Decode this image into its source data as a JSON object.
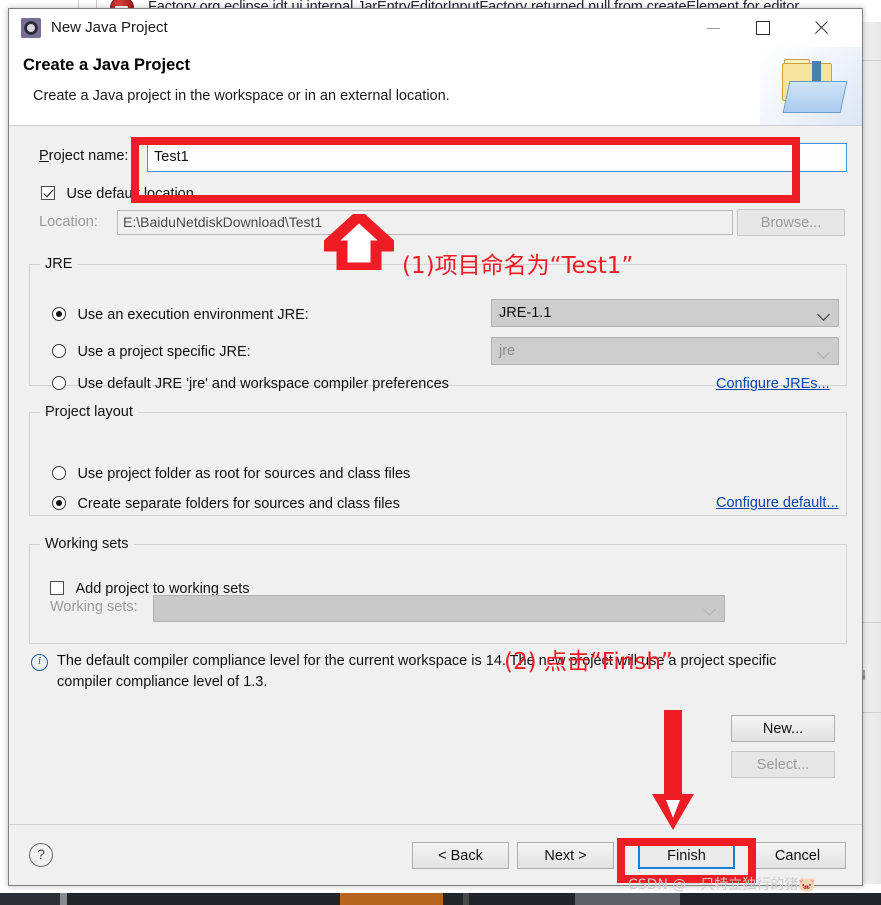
{
  "background": {
    "error_text": "Factory org.eclipse.jdt.ui.internal.JarEntryEditorInputFactory returned null from createElement for editor",
    "error_icon": "error-circle-icon",
    "pin_icon": "pin-icon"
  },
  "window": {
    "title": "New Java Project",
    "app_icon": "eclipse-gear-icon",
    "minimize_label": "Minimize",
    "maximize_label": "Maximize",
    "close_label": "Close"
  },
  "header": {
    "title": "Create a Java Project",
    "subtitle": "Create a Java project in the workspace or in an external location.",
    "banner_icon": "java-project-folder-icon"
  },
  "form": {
    "project_name_label": "Project name:",
    "project_name_value": "Test1",
    "project_name_placeholder": "",
    "use_default_location_label": "Use default location",
    "use_default_location_checked": true,
    "location_label": "Location:",
    "location_value": "E:\\BaiduNetdiskDownload\\Test1",
    "browse_label": "Browse..."
  },
  "jre": {
    "group_label": "JRE",
    "option_exec_env_label": "Use an execution environment JRE:",
    "option_exec_env_selected": true,
    "exec_env_value": "JRE-1.1",
    "option_project_specific_label": "Use a project specific JRE:",
    "option_project_specific_selected": false,
    "project_specific_value": "jre",
    "option_default_label": "Use default JRE 'jre' and workspace compiler preferences",
    "option_default_selected": false,
    "configure_link": "Configure JREs..."
  },
  "layout": {
    "group_label": "Project layout",
    "option_root_label": "Use project folder as root for sources and class files",
    "option_root_selected": false,
    "option_separate_label": "Create separate folders for sources and class files",
    "option_separate_selected": true,
    "configure_link": "Configure default..."
  },
  "working_sets": {
    "group_label": "Working sets",
    "add_project_label": "Add project to working sets",
    "add_project_checked": false,
    "working_sets_label": "Working sets:",
    "working_sets_value": "",
    "new_label": "New...",
    "select_label": "Select..."
  },
  "info": {
    "icon": "info-icon",
    "message": "The default compiler compliance level for the current workspace is 14. The new project will use a project specific compiler compliance level of 1.3."
  },
  "footer": {
    "help_label": "?",
    "back_label": "< Back",
    "next_label": "Next >",
    "finish_label": "Finish",
    "cancel_label": "Cancel"
  },
  "annotations": {
    "accent_color": "#ee1c25",
    "step1_text": "(1)项目命名为“Test1”",
    "step2_text": "(2) 点击“Finsh”",
    "arrow_up_icon": "arrow-up-outline-icon",
    "arrow_down_icon": "arrow-down-solid-icon",
    "watermark": "CSDN @一只特立独行的猪🐷"
  }
}
